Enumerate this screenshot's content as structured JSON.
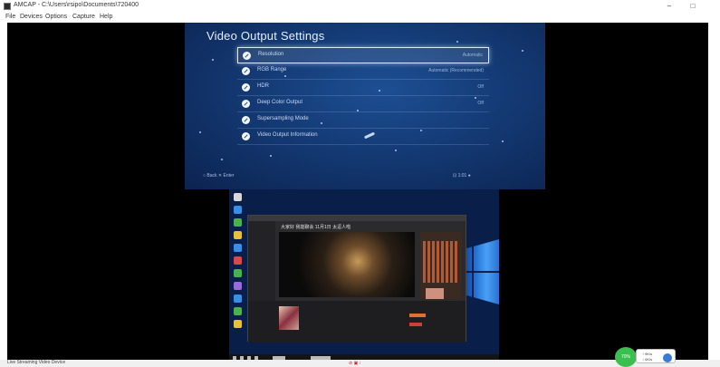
{
  "window": {
    "title": "AMCAP - C:\\Users\\rsipo\\Documents\\720400",
    "minimize_glyph": "–",
    "maximize_glyph": "□"
  },
  "menu": {
    "items": [
      "File",
      "Devices",
      "Options",
      "Capture",
      "Help"
    ]
  },
  "ps4": {
    "title": "Video Output Settings",
    "rows": [
      {
        "label": "Resolution",
        "value": "Automatic",
        "selected": true
      },
      {
        "label": "RGB Range",
        "value": "Automatic (Recommended)",
        "selected": false
      },
      {
        "label": "HDR",
        "value": "Off",
        "selected": false
      },
      {
        "label": "Deep Color Output",
        "value": "Off",
        "selected": false
      },
      {
        "label": "Supersampling Mode",
        "value": "",
        "selected": false
      },
      {
        "label": "Video Output Information",
        "value": "",
        "selected": false
      }
    ],
    "footer_left": "○ Back   ✕ Enter",
    "footer_right": "⊡ 1:01 ●"
  },
  "desktop": {
    "obs_caption": "大家好 我能聊会 11月1日 太逗人啦"
  },
  "status": {
    "text": "Live Streaming Video Device",
    "center_control": "⊘ ▣ ⁝"
  },
  "widget": {
    "rec_label": "70%",
    "line1": "↑ 9K/s",
    "line2": "↓ 0K/s"
  },
  "colors": {
    "ps4_background": "#143a74",
    "rec_green": "#3bbf4e"
  }
}
